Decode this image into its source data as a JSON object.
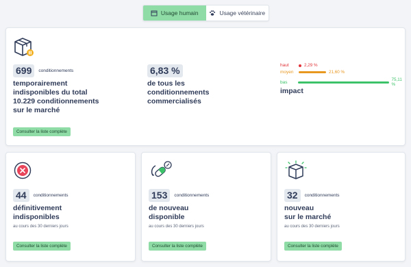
{
  "toggle": {
    "human_label": "Usage humain",
    "vet_label": "Usage vétérinaire"
  },
  "temporary": {
    "count": "699",
    "unit": "conditionnements",
    "desc_line1": "temporairement",
    "desc_line2": "indisponibles du total",
    "desc_line3": "10.229 conditionnements",
    "desc_line4": "sur le marché",
    "button": "Consulter la liste complète"
  },
  "percent": {
    "value": "6,83 %",
    "desc_line1": "de tous les",
    "desc_line2": "conditionnements",
    "desc_line3": "commercialisés"
  },
  "impact": {
    "title": "impact",
    "rows": [
      {
        "label": "haut",
        "pct": "2,29 %",
        "value": 2.29,
        "color": "#e0343a"
      },
      {
        "label": "moyen",
        "pct": "21,60 %",
        "value": 21.6,
        "color": "#e8971f"
      },
      {
        "label": "bas",
        "pct": "75,11 %",
        "value": 75.11,
        "color": "#3cc36a"
      }
    ]
  },
  "definitive": {
    "count": "44",
    "unit": "conditionnements",
    "desc_line1": "définitivement",
    "desc_line2": "indisponibles",
    "sub": "au cours des 30 derniers jours",
    "button": "Consulter la liste complète"
  },
  "available_again": {
    "count": "153",
    "unit": "conditionnements",
    "desc_line1": "de nouveau",
    "desc_line2": "disponible",
    "sub": "au cours des 30 derniers jours",
    "button": "Consulter la liste complète"
  },
  "new_market": {
    "count": "32",
    "unit": "conditionnements",
    "desc_line1": "nouveau",
    "desc_line2": "sur le marché",
    "sub": "au cours des 30 derniers jours",
    "button": "Consulter la liste complète"
  }
}
